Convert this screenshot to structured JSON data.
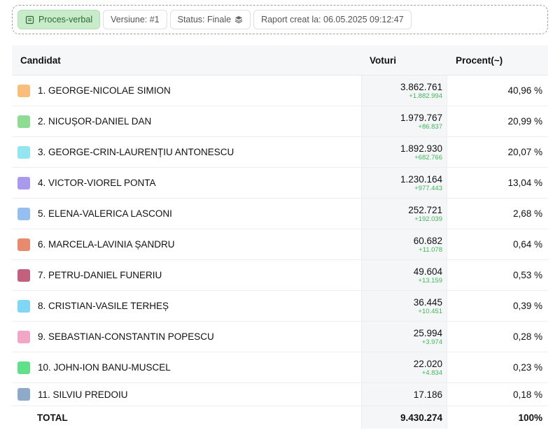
{
  "toolbar": {
    "proces_verbal": "Proces-verbal",
    "version": "Versiune: #1",
    "status": "Status: Finale",
    "report": "Raport creat la: 06.05.2025 09:12:47"
  },
  "table": {
    "headers": {
      "candidate": "Candidat",
      "votes": "Voturi",
      "percent": "Procent(~)"
    },
    "rows": [
      {
        "name": "1. GEORGE-NICOLAE SIMION",
        "votes": "3.862.761",
        "delta": "+1.882.994",
        "percent": "40,96 %",
        "color": "#f9bf7a"
      },
      {
        "name": "2. NICUȘOR-DANIEL DAN",
        "votes": "1.979.767",
        "delta": "+86.837",
        "percent": "20,99 %",
        "color": "#8edb93"
      },
      {
        "name": "3. GEORGE-CRIN-LAURENȚIU ANTONESCU",
        "votes": "1.892.930",
        "delta": "+682.766",
        "percent": "20,07 %",
        "color": "#93e6f0"
      },
      {
        "name": "4. VICTOR-VIOREL PONTA",
        "votes": "1.230.164",
        "delta": "+977.443",
        "percent": "13,04 %",
        "color": "#a99af0"
      },
      {
        "name": "5. ELENA-VALERICA LASCONI",
        "votes": "252.721",
        "delta": "+192.039",
        "percent": "2,68 %",
        "color": "#94bff0"
      },
      {
        "name": "6. MARCELA-LAVINIA ȘANDRU",
        "votes": "60.682",
        "delta": "+11.078",
        "percent": "0,64 %",
        "color": "#e88a6e"
      },
      {
        "name": "7. PETRU-DANIEL FUNERIU",
        "votes": "49.604",
        "delta": "+13.159",
        "percent": "0,53 %",
        "color": "#c2607e"
      },
      {
        "name": "8. CRISTIAN-VASILE TERHEȘ",
        "votes": "36.445",
        "delta": "+10.451",
        "percent": "0,39 %",
        "color": "#7fd6f5"
      },
      {
        "name": "9. SEBASTIAN-CONSTANTIN POPESCU",
        "votes": "25.994",
        "delta": "+3.974",
        "percent": "0,28 %",
        "color": "#f4a6c8"
      },
      {
        "name": "10. JOHN-ION BANU-MUSCEL",
        "votes": "22.020",
        "delta": "+4.834",
        "percent": "0,23 %",
        "color": "#5fe089"
      },
      {
        "name": "11. SILVIU PREDOIU",
        "votes": "17.186",
        "delta": "",
        "percent": "0,18 %",
        "color": "#8fa9c9"
      }
    ],
    "total": {
      "label": "TOTAL",
      "votes": "9.430.274",
      "percent": "100%"
    }
  },
  "icons": {
    "proces_verbal": "document-icon",
    "status": "layers-icon"
  }
}
